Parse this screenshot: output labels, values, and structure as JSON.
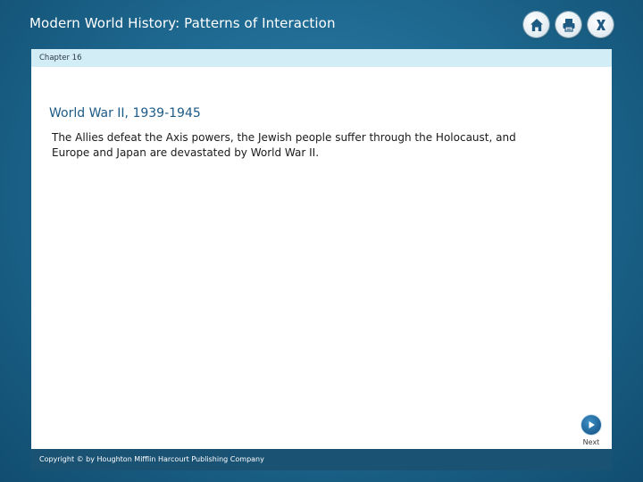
{
  "window": {
    "title": "Modern World History: Patterns of Interaction"
  },
  "toolbar": {
    "buttons": [
      {
        "icon": "home-icon"
      },
      {
        "icon": "print-icon"
      },
      {
        "icon": "close-icon"
      }
    ]
  },
  "chapter": {
    "label": "Chapter 16"
  },
  "main": {
    "heading": "World War II, 1939-1945",
    "body": "The Allies defeat the Axis powers, the Jewish people suffer through the Holocaust, and Europe and Japan are devastated by World War II."
  },
  "navigation": {
    "next_label": "Next"
  },
  "footer": {
    "copyright": "Copyright © by Houghton Mifflin Harcourt Publishing Company"
  },
  "colors": {
    "background": "#1f6a92",
    "chapter_bar": "#d3edf6",
    "heading": "#1c5a86",
    "footer": "#1a5274",
    "icon": "#1f5a83"
  }
}
